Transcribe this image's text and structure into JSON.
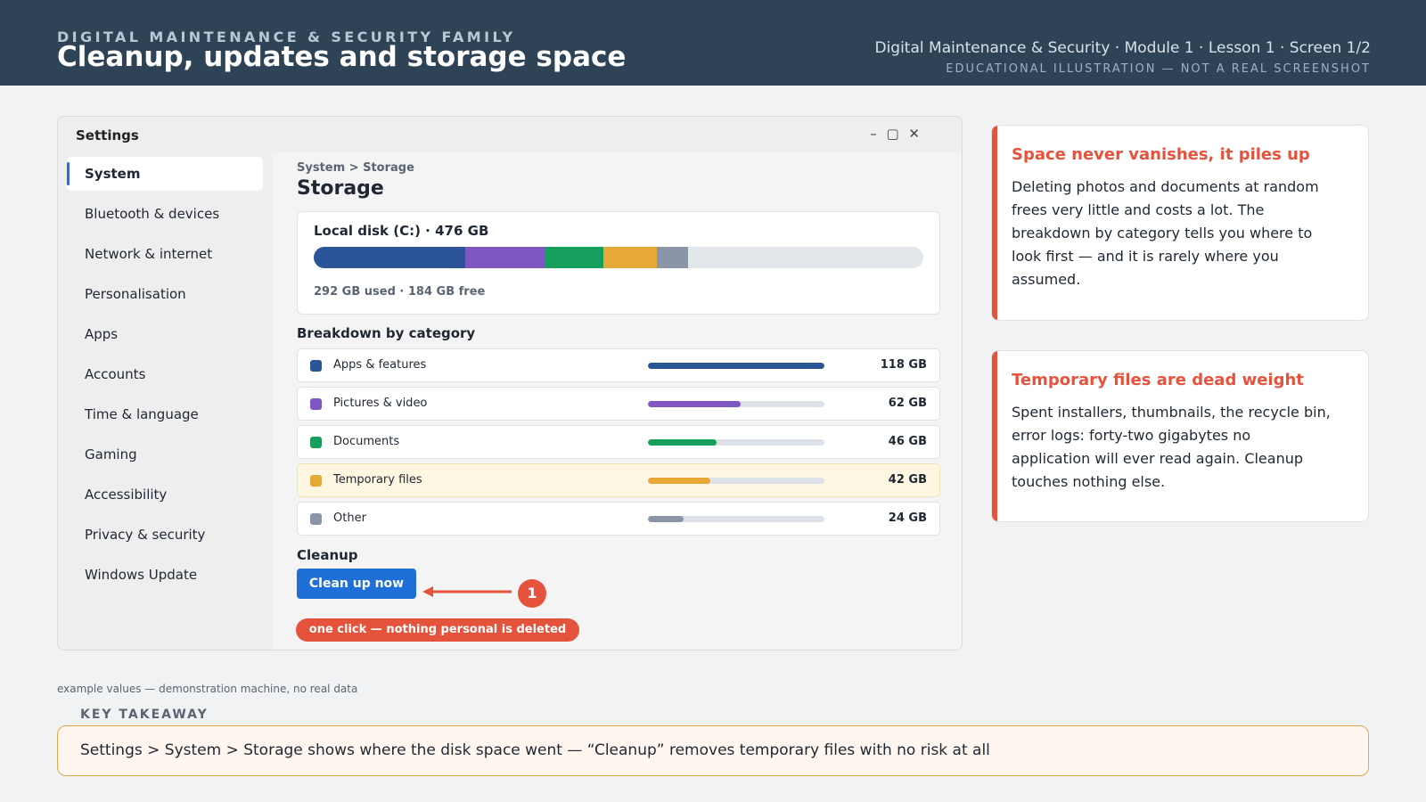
{
  "header": {
    "family": "DIGITAL MAINTENANCE & SECURITY FAMILY",
    "title": "Cleanup, updates and storage space",
    "breadcrumb": "Digital Maintenance & Security · Module 1 · Lesson 1 · Screen 1/2",
    "disclaimer": "EDUCATIONAL ILLUSTRATION — NOT A REAL SCREENSHOT"
  },
  "window": {
    "title": "Settings",
    "controls": "– ▢ ✕"
  },
  "sidebar": {
    "items": [
      {
        "label": "System",
        "active": true
      },
      {
        "label": "Bluetooth & devices"
      },
      {
        "label": "Network & internet"
      },
      {
        "label": "Personalisation"
      },
      {
        "label": "Apps"
      },
      {
        "label": "Accounts"
      },
      {
        "label": "Time & language"
      },
      {
        "label": "Gaming"
      },
      {
        "label": "Accessibility"
      },
      {
        "label": "Privacy & security"
      },
      {
        "label": "Windows Update"
      }
    ]
  },
  "storage": {
    "path": "System > Storage",
    "title": "Storage",
    "disk_label": "Local disk (C:) · 476 GB",
    "disk_total_gb": 476,
    "usage_text": "292 GB used · 184 GB free",
    "breakdown_title": "Breakdown by category",
    "scale_max_gb": 118,
    "categories": [
      {
        "name": "Apps & features",
        "size": "118 GB",
        "gb": 118,
        "color": "#2b5597"
      },
      {
        "name": "Pictures & video",
        "size": "62 GB",
        "gb": 62,
        "color": "#7e57c2"
      },
      {
        "name": "Documents",
        "size": "46 GB",
        "gb": 46,
        "color": "#17a05d"
      },
      {
        "name": "Temporary files",
        "size": "42 GB",
        "gb": 42,
        "color": "#e6a837",
        "highlight": true
      },
      {
        "name": "Other",
        "size": "24 GB",
        "gb": 24,
        "color": "#8a96a8"
      }
    ],
    "cleanup_title": "Cleanup",
    "cleanup_button": "Clean up now",
    "step_number": "1",
    "pill_text": "one click — nothing personal is deleted"
  },
  "notes": [
    {
      "title": "Space never vanishes, it piles up",
      "body": "Deleting photos and documents at random frees very little and costs a lot. The breakdown by category tells you where to look first — and it is rarely where you assumed."
    },
    {
      "title": "Temporary files are dead weight",
      "body": "Spent installers, thumbnails, the recycle bin, error logs: forty-two gigabytes no application will ever read again. Cleanup touches nothing else."
    }
  ],
  "footer": {
    "example_note": "example values — demonstration machine, no real data",
    "takeaway_label": "KEY TAKEAWAY",
    "takeaway_text": "Settings > System > Storage shows where the disk space went — “Cleanup” removes temporary files with no risk at all"
  }
}
